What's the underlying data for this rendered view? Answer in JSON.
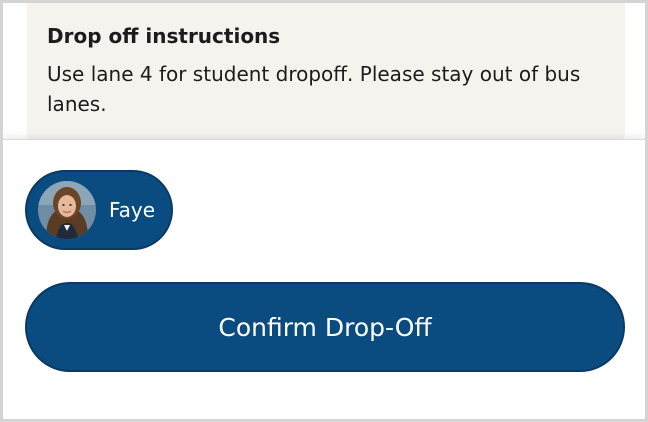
{
  "instructions": {
    "title": "Drop off instructions",
    "body": "Use lane 4 for student dropoff. Please stay out of bus lanes."
  },
  "student": {
    "name": "Faye",
    "avatar_icon": "student-photo"
  },
  "actions": {
    "confirm_label": "Confirm Drop-Off"
  },
  "colors": {
    "primary": "#0b4c80",
    "card_background": "#f6f3ef",
    "text": "#1c1c1c"
  }
}
